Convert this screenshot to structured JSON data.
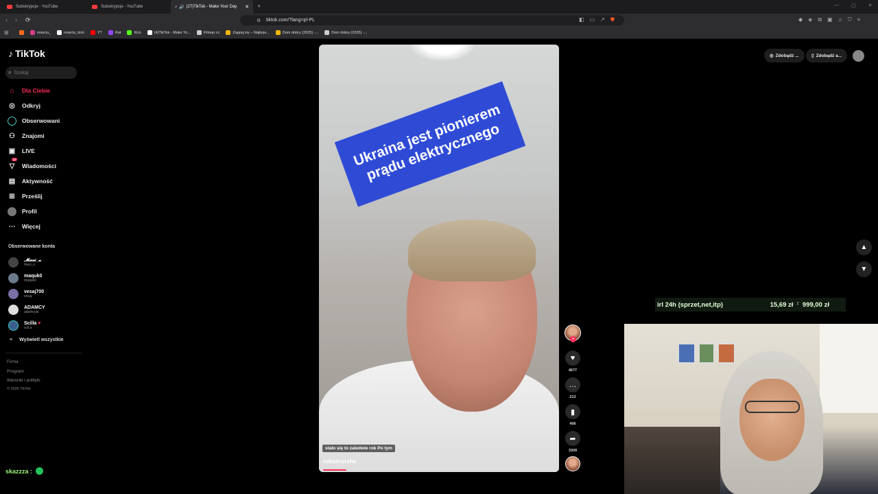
{
  "browser": {
    "tabs": [
      {
        "label": "Subskrypcje - YouTube",
        "color": "#ff3b3b"
      },
      {
        "label": "Subskrypcje - YouTube",
        "color": "#ff3b3b"
      },
      {
        "label": "(27)TikTok - Make Your Day",
        "color": "#ffffff"
      }
    ],
    "url": "tiktok.com/?lang=pl-PL",
    "bookmarks": [
      {
        "label": "",
        "color": "#ff6b1a"
      },
      {
        "label": "nowciu_",
        "color": "#d63f8c"
      },
      {
        "label": "nowciu_kick",
        "color": "#ffffff"
      },
      {
        "label": "YT",
        "color": "#ff0000"
      },
      {
        "label": "Rat",
        "color": "#9146ff"
      },
      {
        "label": "Kick",
        "color": "#53fc18"
      },
      {
        "label": "(4)TikTok - Make Yo...",
        "color": "#ffffff"
      },
      {
        "label": "Filman.cc",
        "color": "#cccccc"
      },
      {
        "label": "Zagraj.my – Najleps...",
        "color": "#f2b705"
      },
      {
        "label": "Dom dobry (2025) -...",
        "color": "#f2b705"
      },
      {
        "label": "Dom dobry (2025) -...",
        "color": "#cccccc"
      }
    ]
  },
  "tiktok": {
    "logo": "TikTok",
    "search_placeholder": "Szukaj",
    "nav": [
      {
        "label": "Dla Ciebie",
        "icon": "home-icon"
      },
      {
        "label": "Odkryj",
        "icon": "compass-icon"
      },
      {
        "label": "Obserwowani",
        "icon": "following-icon"
      },
      {
        "label": "Znajomi",
        "icon": "friends-icon"
      },
      {
        "label": "LIVE",
        "icon": "live-icon"
      },
      {
        "label": "Wiadomości",
        "icon": "messages-icon",
        "badge": "27"
      },
      {
        "label": "Aktywność",
        "icon": "activity-icon"
      },
      {
        "label": "Prześlij",
        "icon": "upload-icon"
      },
      {
        "label": "Profil",
        "icon": "profile-icon"
      },
      {
        "label": "Więcej",
        "icon": "more-icon"
      }
    ],
    "followed_title": "Obserwowane konta",
    "accounts": [
      {
        "name": "𝓜𝓪𝓬𝓲_𝔁",
        "handle": "maci_x"
      },
      {
        "name": "maquk0",
        "handle": "maquk0"
      },
      {
        "name": "vesaj700",
        "handle": "vesaj"
      },
      {
        "name": "ADAMCY",
        "handle": "adamcyai"
      },
      {
        "name": "Scilla",
        "handle": "scil.a"
      }
    ],
    "see_all": "Wyświetl wszystkie",
    "footer": [
      "Firma",
      "Program",
      "Warunki i polityki",
      "© 2026 TikTok"
    ],
    "top_buttons": [
      "Zdobądź ...",
      "Zdobądź a..."
    ],
    "video": {
      "overlay_text": "Ukraina jest pionierem prądu elektrycznego",
      "caption": "stało się to zaledwie rok Po tym",
      "author": "rubasnyrafal",
      "progress": 0.1
    },
    "actions": {
      "likes": "4677",
      "comments": "213",
      "saves": "406",
      "shares": "3309"
    }
  },
  "stream": {
    "chat_user": "skazzza :",
    "goal_label": "irl 24h (sprzet,net,itp)",
    "goal_current": "15,69 zł",
    "goal_separator": "z",
    "goal_target": "999,00 zł"
  }
}
